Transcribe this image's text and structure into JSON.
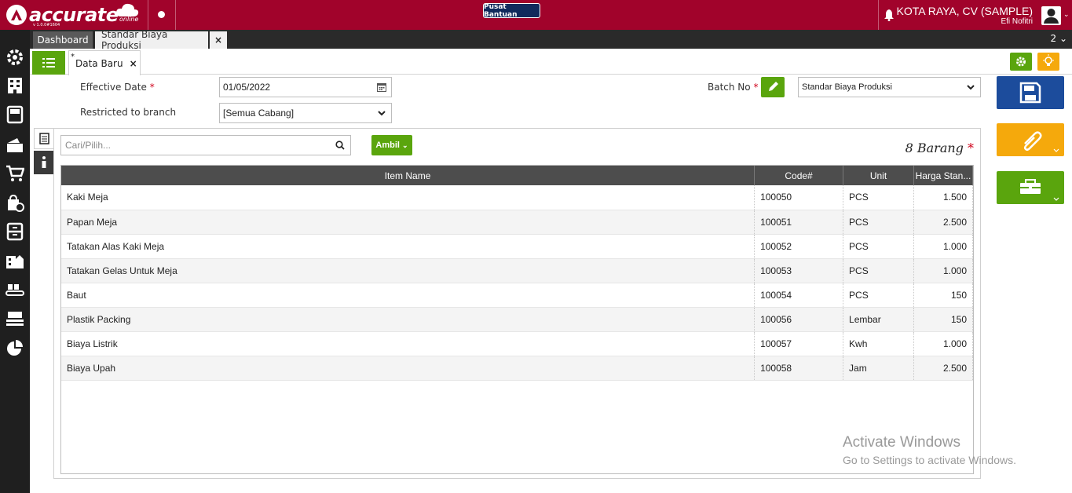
{
  "app": {
    "logo_text": "accurate",
    "logo_sub": "online",
    "version": "v 1.0.0#1604",
    "help_label": "Pusat Bantuan",
    "company_name": "KOTA RAYA, CV (SAMPLE)",
    "user_name": "Efi Nofitri"
  },
  "tabs": {
    "dashboard": "Dashboard",
    "active": "Standar Biaya Produksi",
    "close": "×",
    "count": "2"
  },
  "subbar": {
    "subtab_marker": "*",
    "subtab_label": "Data Baru",
    "subtab_close": "×"
  },
  "form": {
    "effective_date_label": "Effective Date",
    "effective_date_value": "01/05/2022",
    "branch_label": "Restricted to branch",
    "branch_value": "[Semua Cabang]",
    "batch_label": "Batch No",
    "batch_value": "Standar Biaya Produksi",
    "required_mark": "*"
  },
  "items": {
    "search_placeholder": "Cari/Pilih...",
    "ambil_label": "Ambil",
    "count_text": "8 Barang",
    "columns": [
      "Item Name",
      "Code#",
      "Unit",
      "Harga Stan..."
    ],
    "rows": [
      {
        "name": "Kaki Meja",
        "code": "100050",
        "unit": "PCS",
        "price": "1.500"
      },
      {
        "name": "Papan Meja",
        "code": "100051",
        "unit": "PCS",
        "price": "2.500"
      },
      {
        "name": "Tatakan Alas Kaki Meja",
        "code": "100052",
        "unit": "PCS",
        "price": "1.000"
      },
      {
        "name": "Tatakan Gelas Untuk Meja",
        "code": "100053",
        "unit": "PCS",
        "price": "1.000"
      },
      {
        "name": "Baut",
        "code": "100054",
        "unit": "PCS",
        "price": "150"
      },
      {
        "name": "Plastik Packing",
        "code": "100056",
        "unit": "Lembar",
        "price": "150"
      },
      {
        "name": "Biaya Listrik",
        "code": "100057",
        "unit": "Kwh",
        "price": "1.000"
      },
      {
        "name": "Biaya Upah",
        "code": "100058",
        "unit": "Jam",
        "price": "2.500"
      }
    ]
  },
  "watermark": {
    "line1": "Activate Windows",
    "line2": "Go to Settings to activate Windows."
  },
  "colors": {
    "brand": "#a1032b",
    "green": "#5aa50d",
    "orange": "#f5a90c",
    "blue": "#1c4c9c"
  },
  "icons": [
    "settings-icon",
    "building-icon",
    "book-icon",
    "wallet-icon",
    "cart-icon",
    "bag-icon",
    "archive-icon",
    "warehouse-icon",
    "conveyor-icon",
    "tax-icon",
    "pie-chart-icon"
  ]
}
